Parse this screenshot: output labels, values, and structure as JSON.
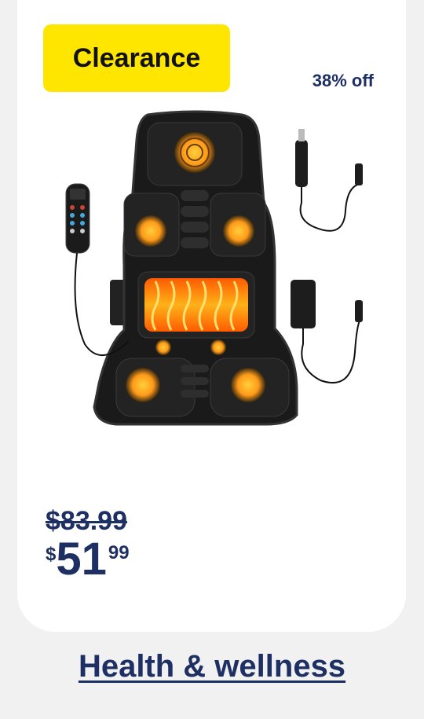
{
  "card": {
    "badge": "Clearance",
    "discount": "38% off",
    "product_image": "heated-massage-seat-cushion-image",
    "original_price": "$83.99",
    "price": {
      "currency": "$",
      "dollars": "51",
      "cents": "99"
    }
  },
  "footer": {
    "category_link": "Health & wellness"
  },
  "colors": {
    "badge_bg": "#ffe600",
    "text_navy": "#1d2f63"
  }
}
